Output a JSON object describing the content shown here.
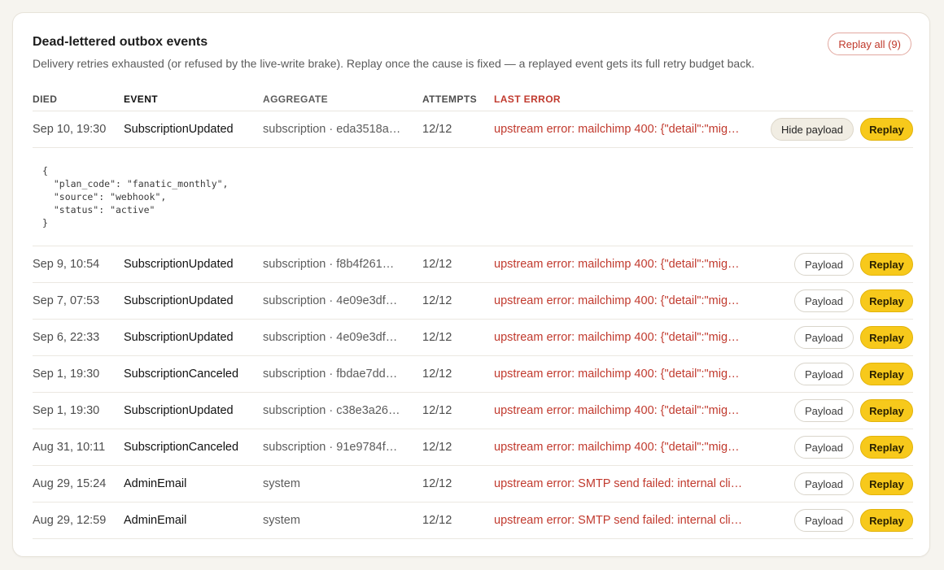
{
  "card": {
    "title": "Dead-lettered outbox events",
    "subtitle": "Delivery retries exhausted (or refused by the live-write brake). Replay once the cause is fixed — a replayed event gets its full retry budget back.",
    "replay_all_label": "Replay all (9)"
  },
  "columns": {
    "died": "DIED",
    "event": "EVENT",
    "aggregate": "AGGREGATE",
    "attempts": "ATTEMPTS",
    "last_error": "LAST ERROR"
  },
  "buttons": {
    "payload": "Payload",
    "hide_payload": "Hide payload",
    "replay": "Replay"
  },
  "rows": [
    {
      "died": "Sep 10, 19:30",
      "event": "SubscriptionUpdated",
      "aggregate": "subscription · eda3518a…",
      "attempts": "12/12",
      "error": "upstream error: mailchimp 400: {\"detail\":\"mig…"
    },
    {
      "died": "Sep 9, 10:54",
      "event": "SubscriptionUpdated",
      "aggregate": "subscription · f8b4f261…",
      "attempts": "12/12",
      "error": "upstream error: mailchimp 400: {\"detail\":\"mig…"
    },
    {
      "died": "Sep 7, 07:53",
      "event": "SubscriptionUpdated",
      "aggregate": "subscription · 4e09e3df…",
      "attempts": "12/12",
      "error": "upstream error: mailchimp 400: {\"detail\":\"mig…"
    },
    {
      "died": "Sep 6, 22:33",
      "event": "SubscriptionUpdated",
      "aggregate": "subscription · 4e09e3df…",
      "attempts": "12/12",
      "error": "upstream error: mailchimp 400: {\"detail\":\"mig…"
    },
    {
      "died": "Sep 1, 19:30",
      "event": "SubscriptionCanceled",
      "aggregate": "subscription · fbdae7dd…",
      "attempts": "12/12",
      "error": "upstream error: mailchimp 400: {\"detail\":\"mig…"
    },
    {
      "died": "Sep 1, 19:30",
      "event": "SubscriptionUpdated",
      "aggregate": "subscription · c38e3a26…",
      "attempts": "12/12",
      "error": "upstream error: mailchimp 400: {\"detail\":\"mig…"
    },
    {
      "died": "Aug 31, 10:11",
      "event": "SubscriptionCanceled",
      "aggregate": "subscription · 91e9784f…",
      "attempts": "12/12",
      "error": "upstream error: mailchimp 400: {\"detail\":\"mig…"
    },
    {
      "died": "Aug 29, 15:24",
      "event": "AdminEmail",
      "aggregate": "system",
      "attempts": "12/12",
      "error": "upstream error: SMTP send failed: internal cli…"
    },
    {
      "died": "Aug 29, 12:59",
      "event": "AdminEmail",
      "aggregate": "system",
      "attempts": "12/12",
      "error": "upstream error: SMTP send failed: internal cli…"
    }
  ],
  "expanded_payload": "{\n  \"plan_code\": \"fanatic_monthly\",\n  \"source\": \"webhook\",\n  \"status\": \"active\"\n}",
  "colors": {
    "accent": "#f7c91b",
    "error": "#c13a2e",
    "background": "#f6f4ef"
  }
}
